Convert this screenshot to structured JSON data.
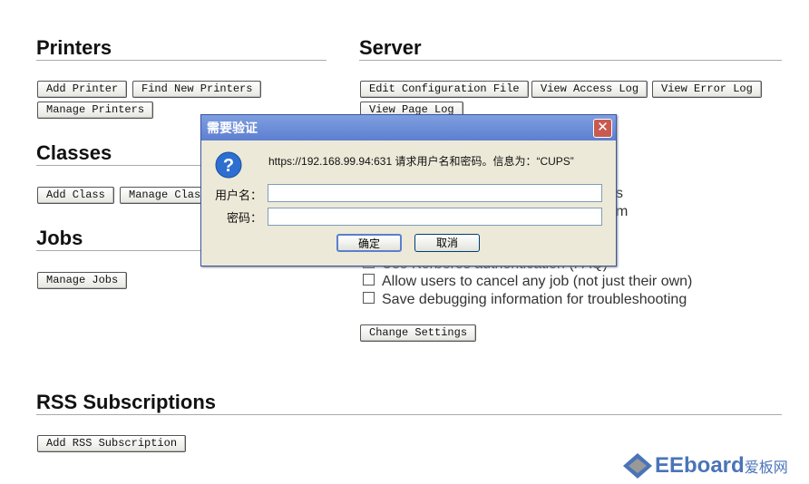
{
  "printers": {
    "title": "Printers",
    "buttons": [
      "Add Printer",
      "Find New Printers",
      "Manage Printers"
    ]
  },
  "classes": {
    "title": "Classes",
    "buttons": [
      "Add Class",
      "Manage Classes"
    ]
  },
  "jobs": {
    "title": "Jobs",
    "buttons": [
      "Manage Jobs"
    ]
  },
  "server": {
    "title": "Server",
    "buttons": [
      "Edit Configuration File",
      "View Access Log",
      "View Error Log",
      "View Page Log"
    ],
    "options": [
      "Use Kerberos authentication (FAQ)",
      "Allow users to cancel any job (not just their own)",
      "Save debugging information for troubleshooting"
    ],
    "partial_fragments": [
      "s",
      "m"
    ],
    "change_settings": "Change Settings"
  },
  "rss": {
    "title": "RSS Subscriptions",
    "buttons": [
      "Add RSS Subscription"
    ]
  },
  "dialog": {
    "title": "需要验证",
    "message": "https://192.168.99.94:631 请求用户名和密码。信息为：“CUPS”",
    "username_label": "用户名：",
    "password_label": "密码：",
    "username_value": "",
    "password_value": "",
    "ok": "确定",
    "cancel": "取消",
    "close": "✕",
    "icon": "question-icon"
  },
  "watermark": {
    "text": "EEboard爱板网"
  }
}
